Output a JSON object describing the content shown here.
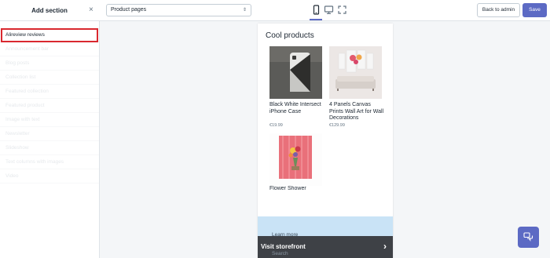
{
  "top_bar": {
    "panel_title": "Add section",
    "close_glyph": "×",
    "page_select_value": "Product pages",
    "page_select_caret": "⌃⌄",
    "devices": [
      "mobile-icon",
      "desktop-icon",
      "fullscreen-icon"
    ],
    "back_to_admin": "Back to admin",
    "save": "Save"
  },
  "sidebar": {
    "items": [
      "Alireview reviews",
      "Announcement bar",
      "Blog posts",
      "Collection list",
      "Featured collection",
      "Featured product",
      "Image with text",
      "Newsletter",
      "Slideshow",
      "Text columns with images",
      "Video"
    ]
  },
  "preview": {
    "collection_title": "Cool products",
    "products": [
      {
        "title": "Black White Intersect iPhone Case",
        "price": "€19.99"
      },
      {
        "title": "4 Panels Canvas Prints Wall Art for Wall Decorations",
        "price": "€129.99"
      },
      {
        "title": "Flower Shower",
        "price": ""
      }
    ],
    "learn_more": "Learn more",
    "visit_storefront": "Visit storefront",
    "visit_arrow": "›",
    "behind_text": "Search"
  },
  "colors": {
    "accent": "#5c6ac4",
    "highlight_border": "#d9282f",
    "band": "#c9e3f6",
    "visit_bar": "#3e4146"
  }
}
